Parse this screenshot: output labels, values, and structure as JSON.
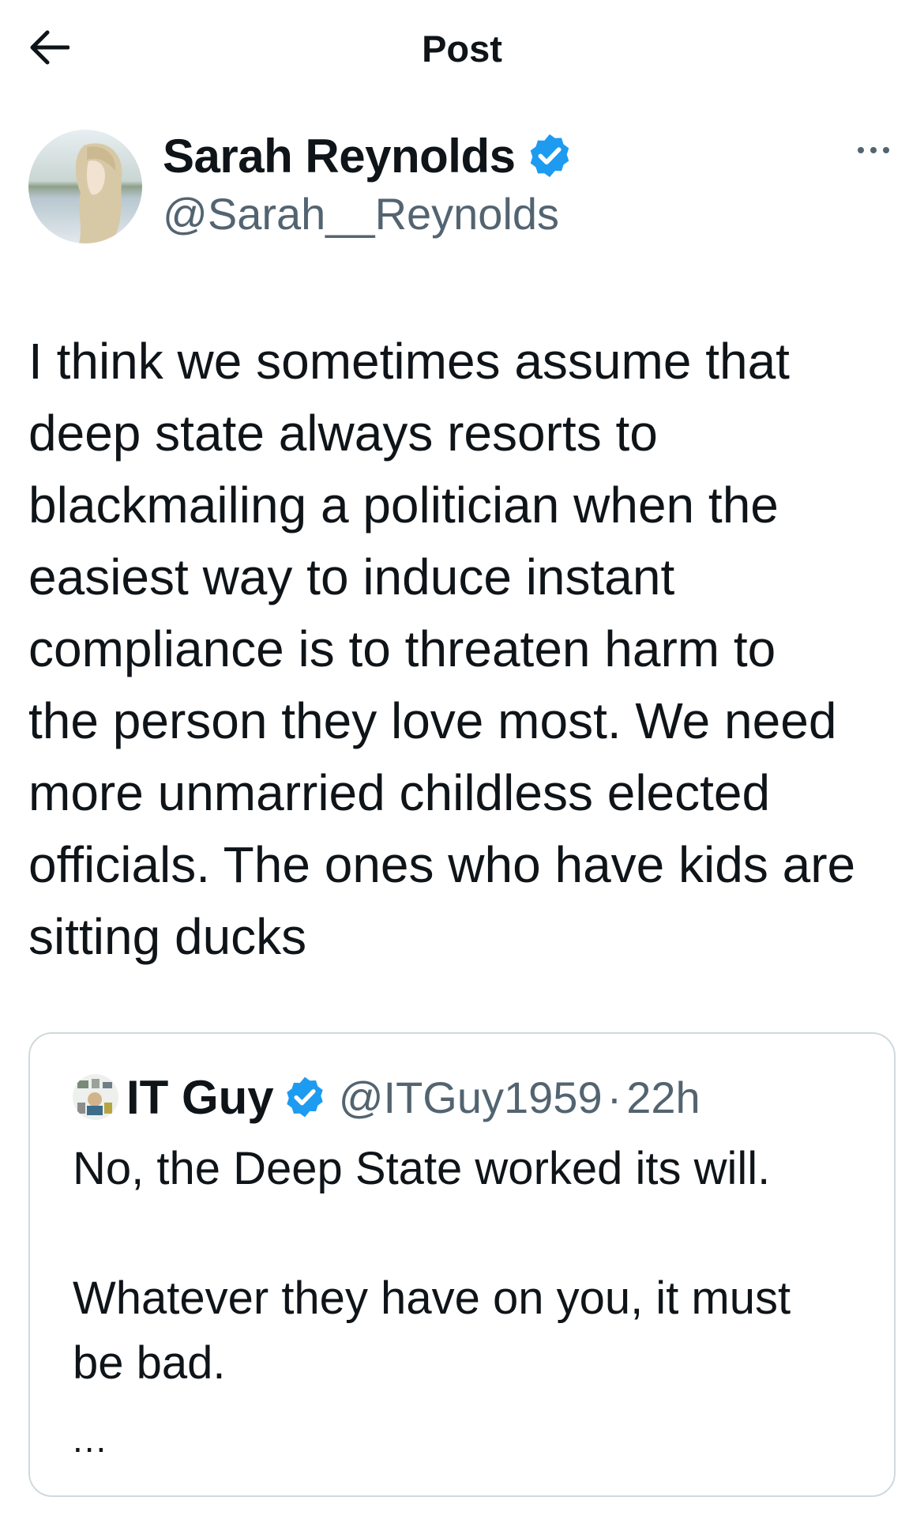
{
  "header": {
    "title": "Post",
    "back_icon": "arrow-left-icon"
  },
  "post": {
    "author": {
      "display_name": "Sarah Reynolds",
      "handle": "@Sarah__Reynolds",
      "verified": true
    },
    "more_icon": "more-horizontal-icon",
    "text": "I think we sometimes assume that\ndeep state always resorts to\nblackmailing a politician when the\neasiest way to induce instant\ncompliance is to threaten harm to\nthe person they love most. We need\nmore unmarried childless elected\nofficials. The ones who have kids are\nsitting ducks"
  },
  "quoted_post": {
    "author": {
      "display_name": "IT Guy",
      "handle": "@ITGuy1959",
      "verified": true
    },
    "separator": "·",
    "time": "22h",
    "text": "No, the Deep State worked its will.\n\nWhatever they have on you, it must\nbe bad.",
    "truncation": "..."
  },
  "colors": {
    "text_primary": "#0f1419",
    "text_secondary": "#536471",
    "verified_blue": "#1d9bf0",
    "border": "#cfd9de"
  }
}
